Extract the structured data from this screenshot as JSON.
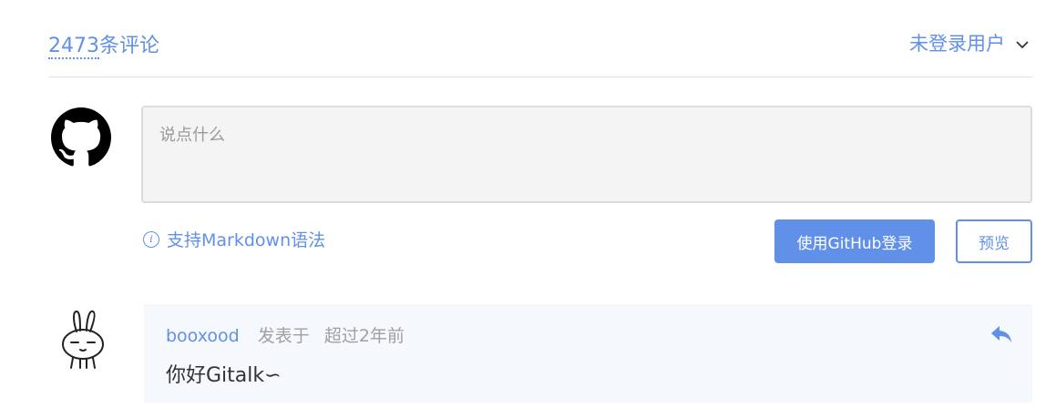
{
  "header": {
    "count": "2473",
    "count_suffix": "条评论",
    "user_label": "未登录用户",
    "chevron": "⌄"
  },
  "editor": {
    "placeholder": "说点什么",
    "value": ""
  },
  "toolbar": {
    "markdown_tip": "支持Markdown语法",
    "info_icon": "i",
    "login_label": "使用GitHub登录",
    "preview_label": "预览"
  },
  "comment": {
    "author": "booxood",
    "posted_label": "发表于",
    "time": "超过2年前",
    "body": "你好Gitalk∽"
  },
  "colors": {
    "accent": "#6190e8",
    "comment_bg": "#f5f8fd",
    "editor_bg": "#f4f4f4"
  },
  "icons": {
    "github": "github-icon",
    "rabbit": "rabbit-avatar-icon",
    "reply": "reply-icon",
    "info": "info-icon",
    "chevron": "chevron-down-icon"
  }
}
